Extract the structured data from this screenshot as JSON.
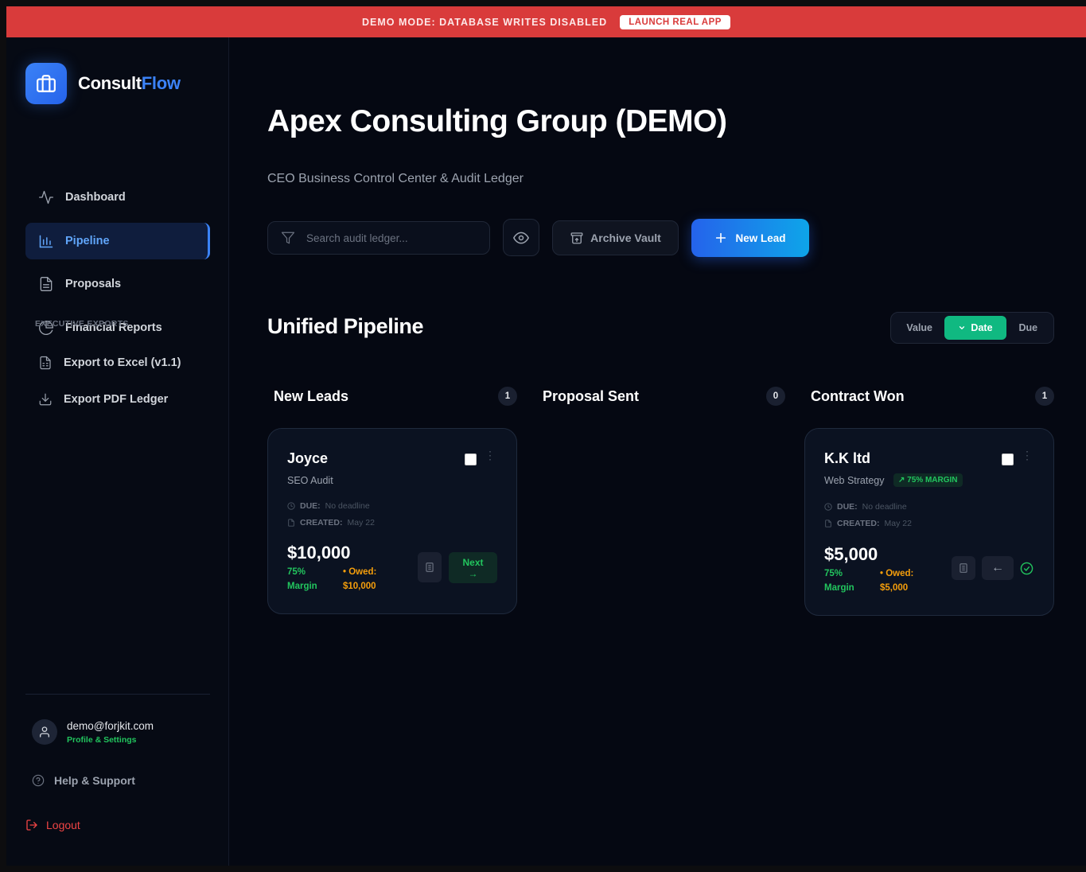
{
  "banner": {
    "text": "DEMO MODE: DATABASE WRITES DISABLED",
    "button": "LAUNCH REAL APP"
  },
  "brand": {
    "name_main": "Consult",
    "name_accent": "Flow",
    "accent_color": "#3b82f6"
  },
  "sidebar": {
    "items": [
      {
        "label": "Dashboard",
        "icon": "activity-icon"
      },
      {
        "label": "Pipeline",
        "icon": "bar-chart-icon",
        "active": true
      },
      {
        "label": "Proposals",
        "icon": "file-text-icon"
      },
      {
        "label": "Financial Reports",
        "icon": "pie-chart-icon"
      }
    ],
    "section_label": "EXECUTIVE EXPORTS",
    "exports": [
      {
        "label": "Export to Excel (v1.1)",
        "icon": "spreadsheet-icon"
      },
      {
        "label": "Export PDF Ledger",
        "icon": "download-icon"
      }
    ],
    "user": {
      "email": "demo@forjkit.com",
      "link": "Profile & Settings"
    },
    "help": "Help & Support",
    "logout": "Logout"
  },
  "header": {
    "title": "Apex Consulting Group (DEMO)",
    "subtitle": "CEO Business Control Center & Audit Ledger"
  },
  "toolbar": {
    "search_placeholder": "Search audit ledger...",
    "archive_label": "Archive Vault",
    "new_lead_label": "New Lead"
  },
  "pipeline": {
    "title": "Unified Pipeline",
    "sort_options": [
      "Value",
      "Date",
      "Due"
    ],
    "sort_active": "Date",
    "columns": [
      {
        "title": "New Leads",
        "count": "1"
      },
      {
        "title": "Proposal Sent",
        "count": "0"
      },
      {
        "title": "Contract Won",
        "count": "1"
      }
    ],
    "cards": {
      "joyce": {
        "name": "Joyce",
        "service": "SEO Audit",
        "due_label": "DUE:",
        "due_value": "No deadline",
        "created_label": "CREATED:",
        "created_value": "May 22",
        "amount": "$10,000",
        "margin_pct": "75%",
        "margin_label": "Margin",
        "owed_label": "• Owed:",
        "owed_value": "$10,000",
        "next_label": "Next",
        "next_arrow": "→"
      },
      "kk": {
        "name": "K.K ltd",
        "service": "Web Strategy",
        "badge": "↗ 75% MARGIN",
        "due_label": "DUE:",
        "due_value": "No deadline",
        "created_label": "CREATED:",
        "created_value": "May 22",
        "amount": "$5,000",
        "margin_pct": "75%",
        "margin_label": "Margin",
        "owed_label": "• Owed:",
        "owed_value": "$5,000",
        "back_arrow": "←"
      }
    }
  },
  "colors": {
    "banner": "#d93b3b",
    "active_sort": "#10b981",
    "primary": "#2563eb",
    "success": "#22c55e",
    "warning": "#f59e0b",
    "danger": "#ef4444"
  }
}
